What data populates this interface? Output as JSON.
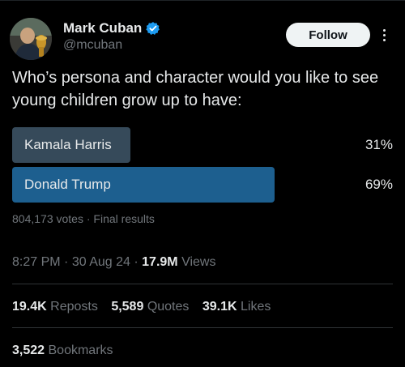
{
  "author": {
    "display_name": "Mark Cuban",
    "handle": "@mcuban",
    "verified": true,
    "avatar_icon": "profile-photo"
  },
  "header": {
    "follow_label": "Follow",
    "more_icon": "more-vertical-icon"
  },
  "tweet": {
    "text": "Who’s persona and character would you like to see young children grow up to have:"
  },
  "poll": {
    "options": [
      {
        "label": "Kamala Harris",
        "percent_text": "31%",
        "percent": 31,
        "winner": false
      },
      {
        "label": "Donald Trump",
        "percent_text": "69%",
        "percent": 69,
        "winner": true
      }
    ],
    "votes": "804,173 votes",
    "separator": "·",
    "status": "Final results"
  },
  "meta": {
    "time": "8:27 PM",
    "date": "30 Aug 24",
    "separator": "·",
    "views_count": "17.9M",
    "views_label": "Views"
  },
  "stats": {
    "reposts_count": "19.4K",
    "reposts_label": "Reposts",
    "quotes_count": "5,589",
    "quotes_label": "Quotes",
    "likes_count": "39.1K",
    "likes_label": "Likes",
    "bookmarks_count": "3,522",
    "bookmarks_label": "Bookmarks"
  },
  "colors": {
    "background": "#000000",
    "text_primary": "#e7e9ea",
    "text_secondary": "#71767b",
    "poll_bar_default": "#364a5a",
    "poll_bar_winner": "#1d5f8f",
    "verified_badge": "#1d9bf0",
    "divider": "#2f3336"
  }
}
